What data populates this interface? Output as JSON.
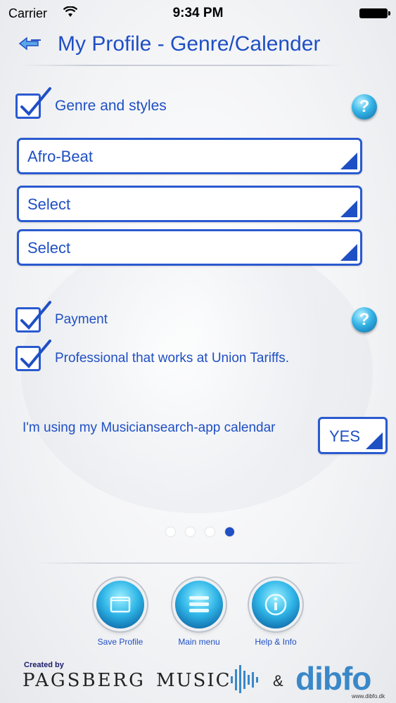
{
  "status_bar": {
    "carrier": "Carrier",
    "time": "9:34 PM",
    "wifi_icon": "wifi-icon",
    "battery_icon": "battery-icon"
  },
  "header": {
    "title": "My Profile - Genre/Calender",
    "back_icon": "back-arrow-icon"
  },
  "genre": {
    "checkbox_label": "Genre and styles",
    "checked": true,
    "dropdowns": [
      {
        "value": "Afro-Beat"
      },
      {
        "value": "Select"
      },
      {
        "value": "Select"
      }
    ]
  },
  "payment": {
    "label": "Payment",
    "checked": true
  },
  "union": {
    "label": "Professional that works at Union Tariffs.",
    "checked": true
  },
  "calendar": {
    "text": "I'm using my Musiciansearch-app calendar",
    "value": "YES"
  },
  "pagination": {
    "pages": 4,
    "active": 4
  },
  "bottom_nav": [
    {
      "label": "Save Profile",
      "icon": "save-icon"
    },
    {
      "label": "Main menu",
      "icon": "menu-icon"
    },
    {
      "label": "Help & Info",
      "icon": "info-icon"
    }
  ],
  "footer": {
    "created_by": "Created by",
    "logo_1": "PAGSBERG",
    "logo_2": "MUSIC",
    "amp": "&",
    "logo_3": "dibfo",
    "url": "www.dibfo.dk"
  },
  "colors": {
    "accent": "#1f4fc4",
    "button_blue": "#30b6e8"
  }
}
